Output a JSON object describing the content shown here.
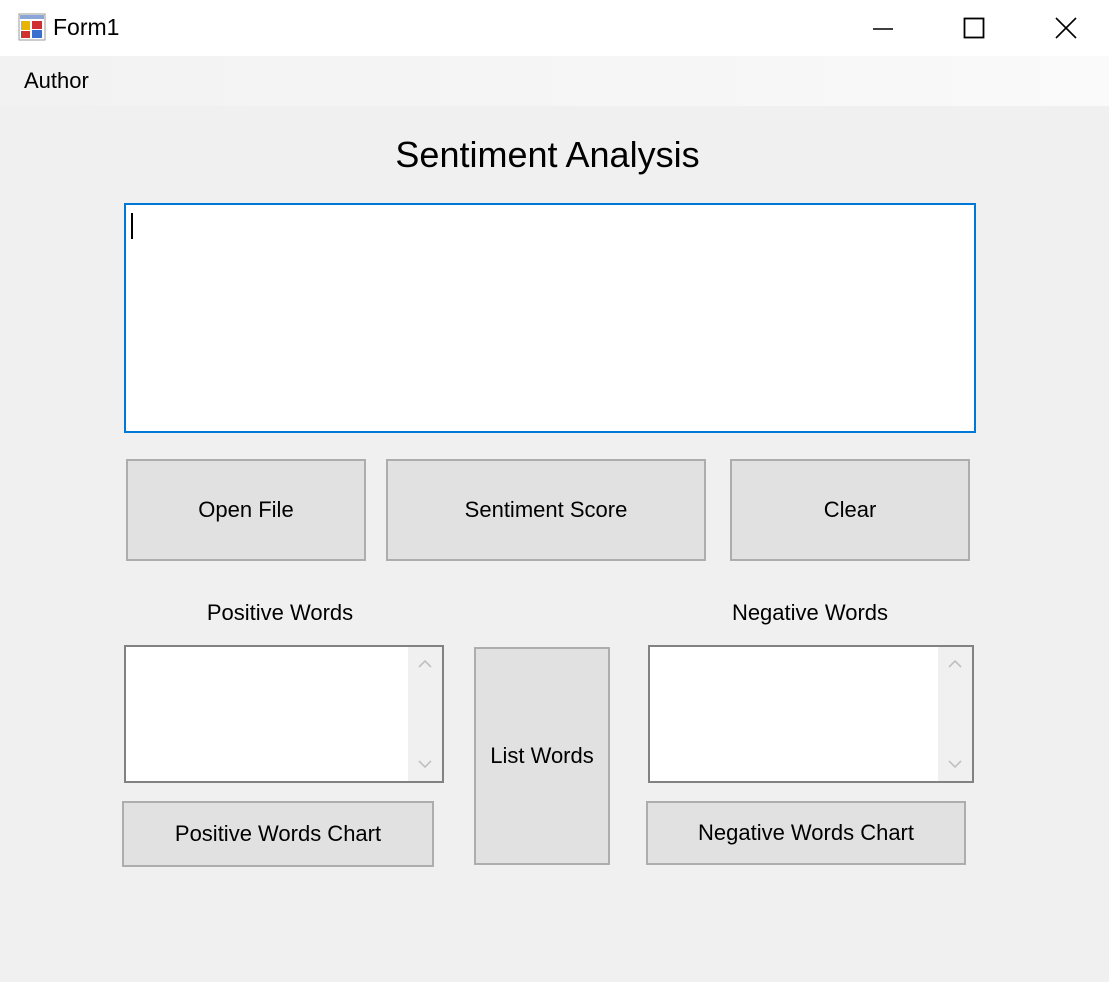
{
  "window": {
    "title": "Form1",
    "icons": {
      "app": "app-form-icon",
      "minimize": "minimize-icon",
      "maximize": "maximize-icon",
      "close": "close-icon"
    }
  },
  "menu": {
    "items": [
      {
        "label": "Author"
      }
    ]
  },
  "form": {
    "heading": "Sentiment Analysis",
    "input_text": "",
    "buttons": {
      "open_file": "Open File",
      "sentiment_score": "Sentiment Score",
      "clear": "Clear",
      "list_words": "List Words",
      "positive_chart": "Positive Words Chart",
      "negative_chart": "Negative Words Chart"
    },
    "positive": {
      "label": "Positive Words",
      "items": []
    },
    "negative": {
      "label": "Negative Words",
      "items": []
    }
  },
  "colors": {
    "focus_border": "#0078d7",
    "button_face": "#e1e1e1",
    "button_border": "#adadad",
    "form_background": "#f0f0f0"
  }
}
